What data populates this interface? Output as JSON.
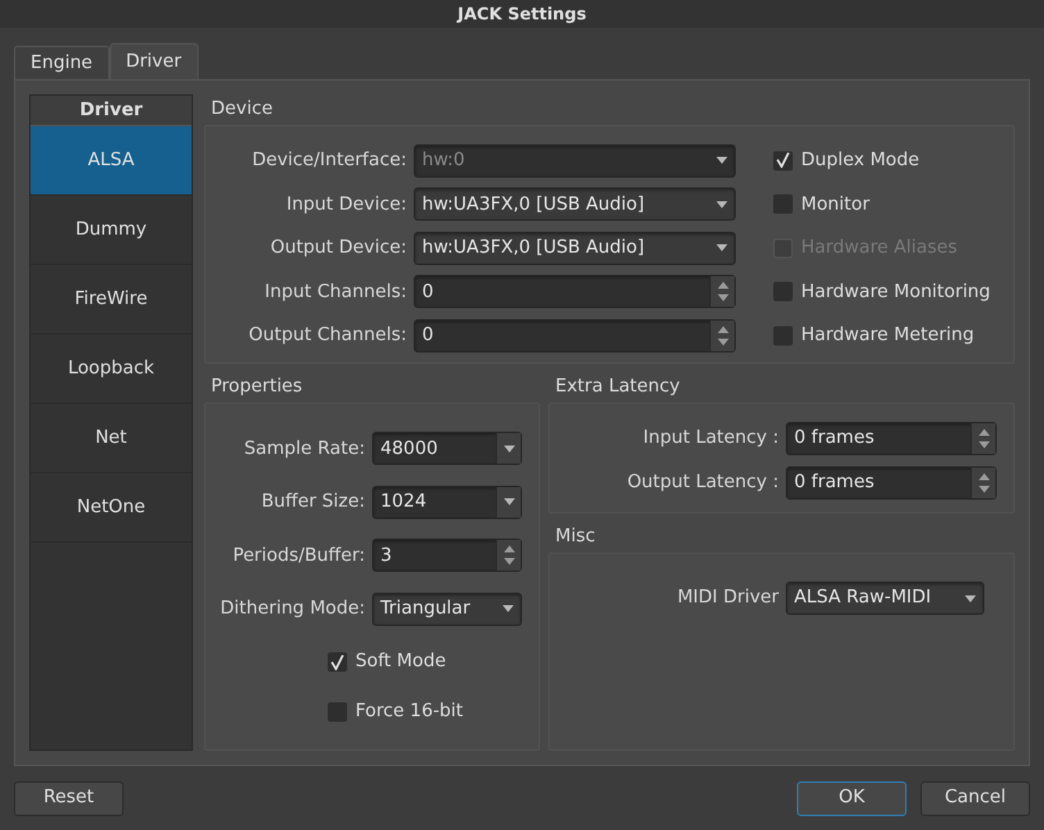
{
  "window": {
    "title": "JACK Settings"
  },
  "tabs": [
    {
      "label": "Engine",
      "selected": false
    },
    {
      "label": "Driver",
      "selected": true
    }
  ],
  "driver_list": {
    "header": "Driver",
    "items": [
      {
        "label": "ALSA",
        "selected": true
      },
      {
        "label": "Dummy",
        "selected": false
      },
      {
        "label": "FireWire",
        "selected": false
      },
      {
        "label": "Loopback",
        "selected": false
      },
      {
        "label": "Net",
        "selected": false
      },
      {
        "label": "NetOne",
        "selected": false
      }
    ]
  },
  "device": {
    "title": "Device",
    "fields": [
      {
        "label": "Device/Interface:",
        "value": "hw:0",
        "kind": "combo",
        "disabled": true
      },
      {
        "label": "Input Device:",
        "value": "hw:UA3FX,0 [USB Audio]",
        "kind": "combo",
        "disabled": false
      },
      {
        "label": "Output Device:",
        "value": "hw:UA3FX,0 [USB Audio]",
        "kind": "combo",
        "disabled": false
      },
      {
        "label": "Input Channels:",
        "value": "0",
        "kind": "spin",
        "disabled": false
      },
      {
        "label": "Output Channels:",
        "value": "0",
        "kind": "spin",
        "disabled": false
      }
    ],
    "options": [
      {
        "label": "Duplex Mode",
        "checked": true,
        "disabled": false
      },
      {
        "label": "Monitor",
        "checked": false,
        "disabled": false
      },
      {
        "label": "Hardware Aliases",
        "checked": false,
        "disabled": true
      },
      {
        "label": "Hardware Monitoring",
        "checked": false,
        "disabled": false
      },
      {
        "label": "Hardware Metering",
        "checked": false,
        "disabled": false
      }
    ]
  },
  "properties": {
    "title": "Properties",
    "fields": [
      {
        "label": "Sample Rate:",
        "value": "48000",
        "kind": "editcombo",
        "disabled": false
      },
      {
        "label": "Buffer Size:",
        "value": "1024",
        "kind": "editcombo",
        "disabled": false
      },
      {
        "label": "Periods/Buffer:",
        "value": "3",
        "kind": "spin",
        "disabled": false
      },
      {
        "label": "Dithering Mode:",
        "value": "Triangular",
        "kind": "combo",
        "disabled": false
      }
    ],
    "options": [
      {
        "label": "Soft Mode",
        "checked": true,
        "disabled": false
      },
      {
        "label": "Force 16-bit",
        "checked": false,
        "disabled": false
      }
    ]
  },
  "extra_latency": {
    "title": "Extra Latency",
    "fields": [
      {
        "label": "Input Latency :",
        "value": "0 frames",
        "kind": "spin",
        "disabled": false
      },
      {
        "label": "Output Latency :",
        "value": "0 frames",
        "kind": "spin",
        "disabled": false
      }
    ]
  },
  "misc": {
    "title": "Misc",
    "fields": [
      {
        "label": "MIDI Driver",
        "value": "ALSA Raw-MIDI",
        "kind": "combo",
        "disabled": false
      }
    ]
  },
  "buttons": [
    {
      "label": "Reset",
      "focused": false
    },
    {
      "label": "OK",
      "focused": true
    },
    {
      "label": "Cancel",
      "focused": false
    }
  ]
}
